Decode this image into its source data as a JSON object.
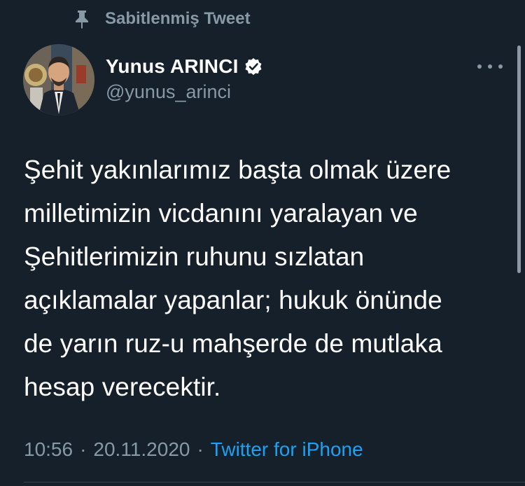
{
  "pinned": {
    "label": "Sabitlenmiş Tweet",
    "icon": "pin-icon"
  },
  "author": {
    "display_name": "Yunus ARINCI",
    "handle": "@yunus_arinci",
    "verified_icon": "verified-badge-icon"
  },
  "tweet": {
    "text": "Şehit yakınlarımız başta olmak üzere\nmilletimizin vicdanını yaralayan ve\nŞehitlerimizin ruhunu sızlatan\naçıklamalar yapanlar; hukuk önünde\nde yarın ruz-u mahşerde de mutlaka\nhesap verecektir.",
    "time": "10:56",
    "separator": "·",
    "date": "20.11.2020",
    "source": "Twitter for iPhone"
  },
  "colors": {
    "background": "#15202b",
    "text": "#ffffff",
    "muted": "#8899a6",
    "accent": "#1da1f2"
  }
}
